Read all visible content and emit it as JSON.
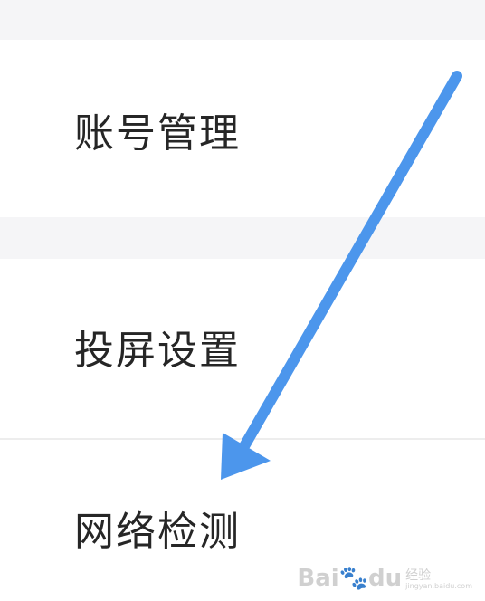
{
  "settings_list": {
    "items": [
      {
        "label": "账号管理"
      },
      {
        "label": "投屏设置"
      },
      {
        "label": "网络检测"
      }
    ]
  },
  "annotation": {
    "arrow_color": "#4c96ec"
  },
  "watermark": {
    "brand": "Bai",
    "brand_suffix": "du",
    "chinese": "经验",
    "url": "jingyan.baidu.com"
  }
}
